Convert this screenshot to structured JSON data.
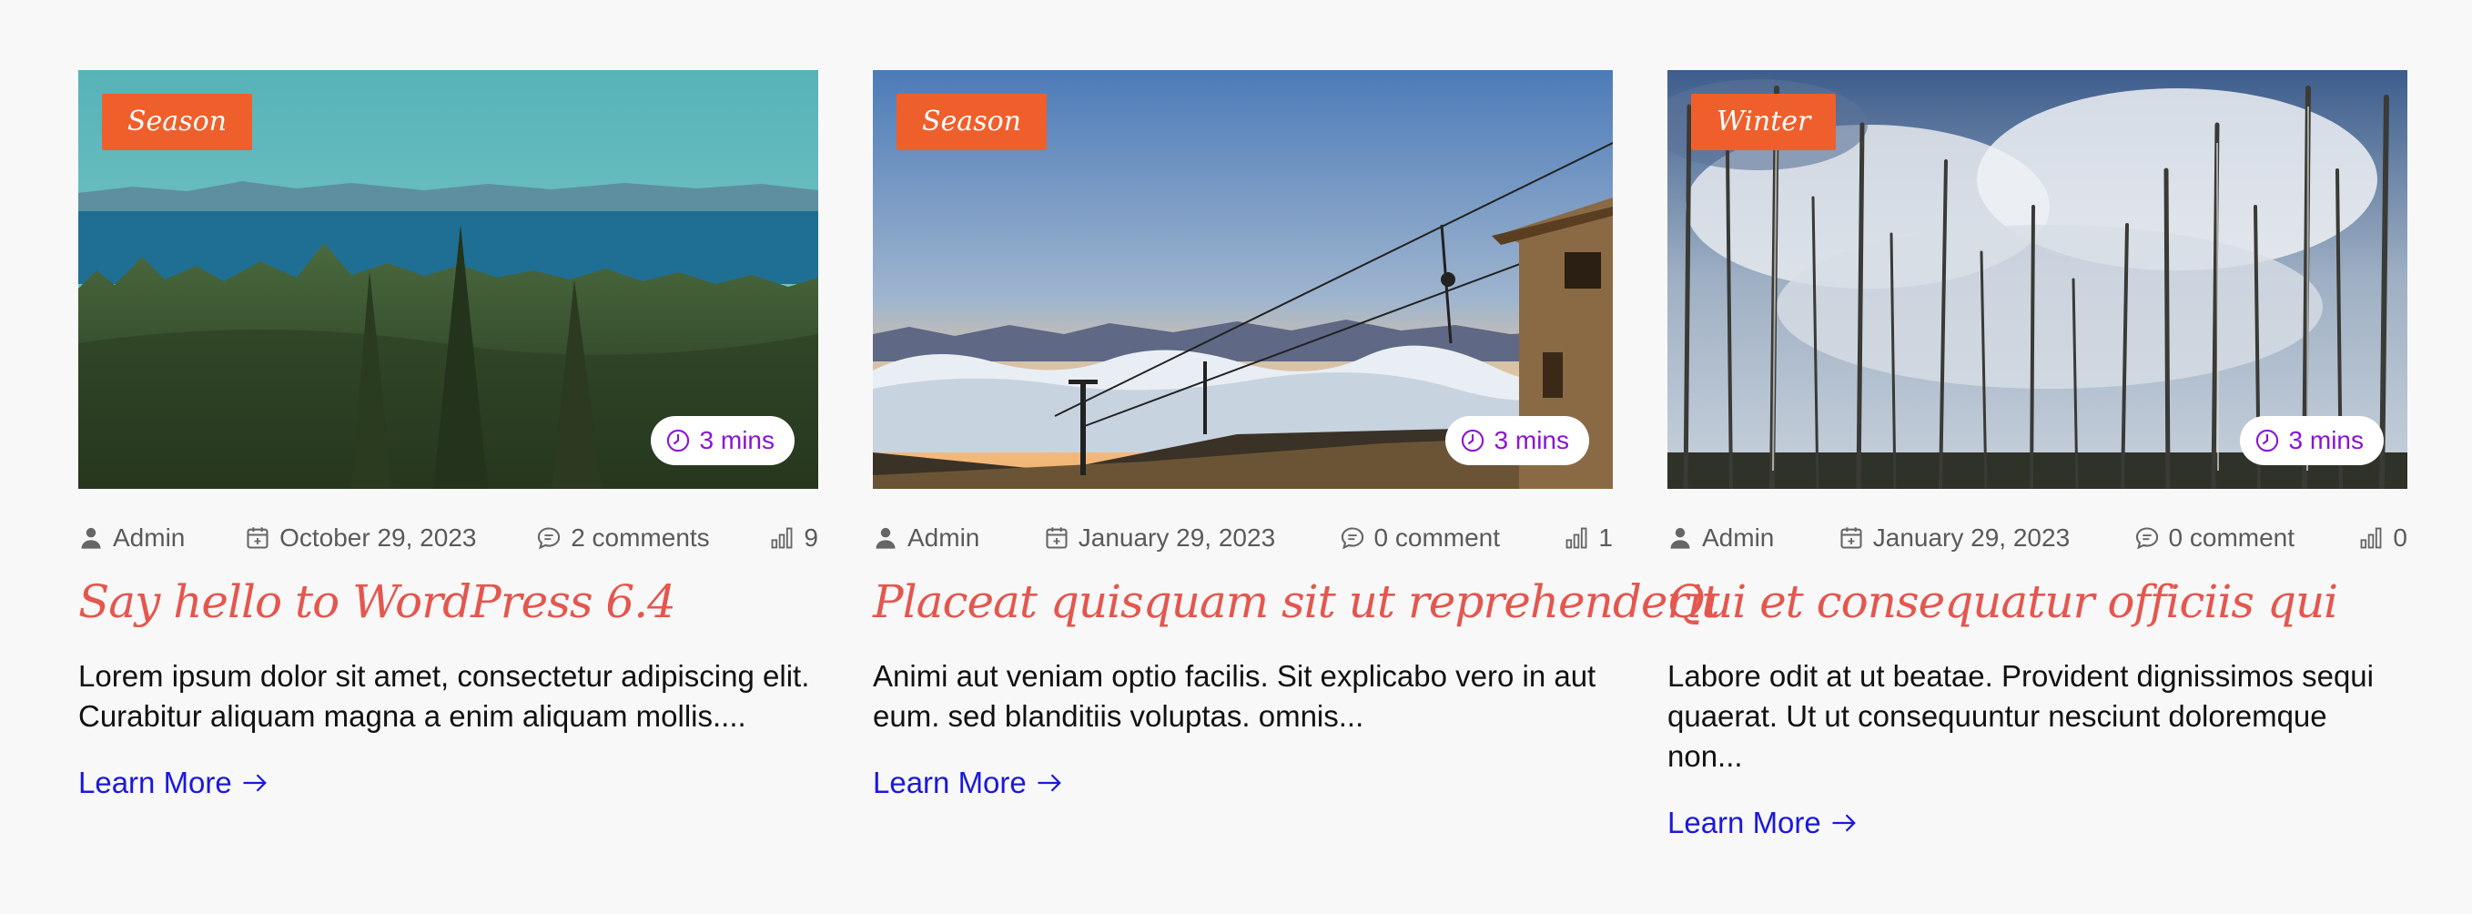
{
  "posts": [
    {
      "category": "Season",
      "read_time": "3 mins",
      "author": "Admin",
      "date": "October 29, 2023",
      "comments": "2 comments",
      "views": "9",
      "title": "Say hello to WordPress 6.4",
      "excerpt": "Lorem ipsum dolor sit amet, consectetur adipiscing elit. Curabitur aliquam magna a enim aliquam mollis....",
      "link_label": "Learn More",
      "image": "forest-lake-mountains-photo"
    },
    {
      "category": "Season",
      "read_time": "3 mins",
      "author": "Admin",
      "date": "January 29, 2023",
      "comments": "0 comment",
      "views": "1",
      "title": "Placeat quisquam sit ut reprehenderit",
      "excerpt": "Animi aut veniam optio facilis. Sit explicabo vero in aut eum. sed blanditiis voluptas. omnis...",
      "link_label": "Learn More",
      "image": "ski-lift-sunset-photo"
    },
    {
      "category": "Winter",
      "read_time": "3 mins",
      "author": "Admin",
      "date": "January 29, 2023",
      "comments": "0 comment",
      "views": "0",
      "title": "Qui et consequatur officiis qui",
      "excerpt": "Labore odit at ut beatae. Provident dignissimos sequi quaerat. Ut ut consequuntur nesciunt doloremque non...",
      "link_label": "Learn More",
      "image": "bare-trees-cloudy-sky-photo"
    }
  ],
  "colors": {
    "badge": "#ef5f2c",
    "title": "#e4574e",
    "link": "#1b19d9",
    "read_time": "#8a13d6"
  },
  "icons": {
    "author": "user-icon",
    "date": "calendar-icon",
    "comments": "comment-icon",
    "views": "bar-chart-icon",
    "read_time": "clock-icon",
    "link": "arrow-right-icon"
  }
}
